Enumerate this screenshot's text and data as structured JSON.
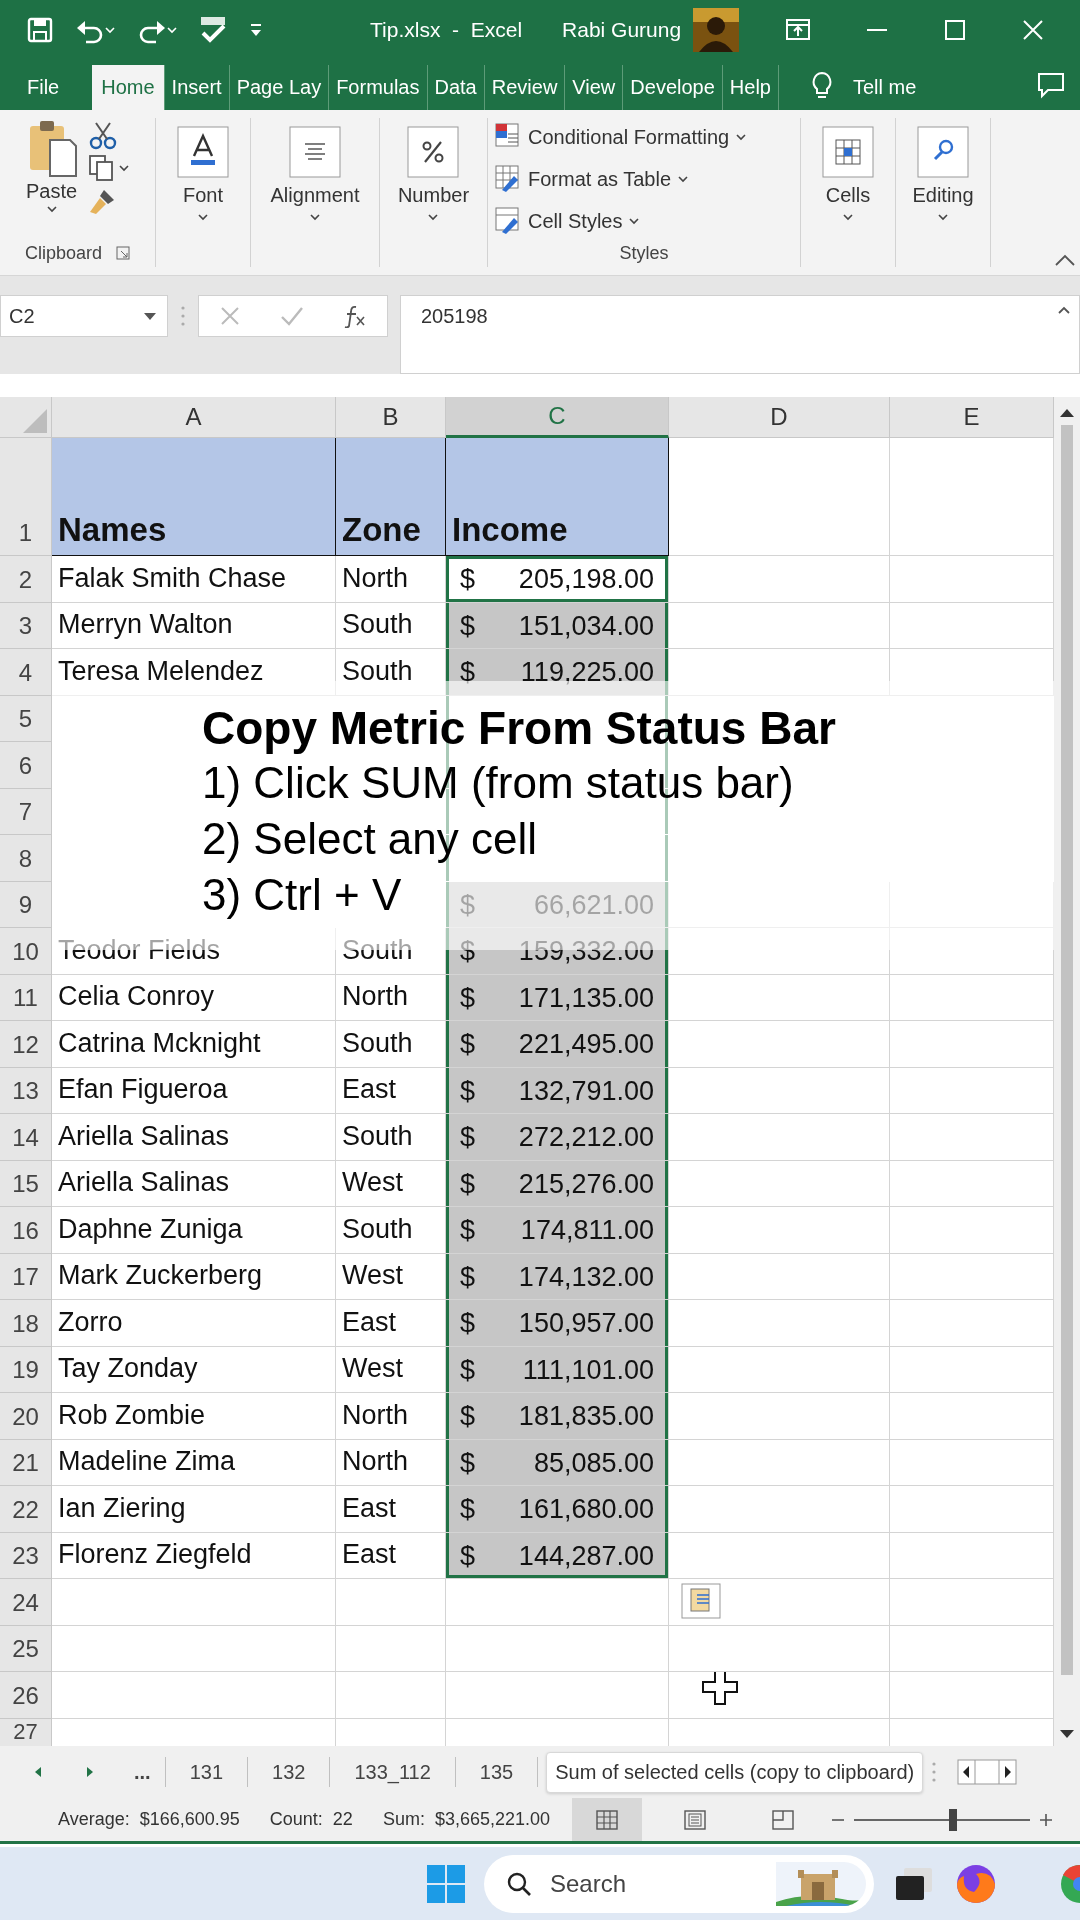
{
  "title_bar": {
    "file_title": "Tip.xlsx  -  Excel",
    "user": "Rabi Gurung"
  },
  "ribbon_tabs": [
    {
      "label": "File",
      "selected": false
    },
    {
      "label": "Home",
      "selected": true
    },
    {
      "label": "Insert",
      "selected": false
    },
    {
      "label": "Page Lay",
      "selected": false
    },
    {
      "label": "Formulas",
      "selected": false
    },
    {
      "label": "Data",
      "selected": false
    },
    {
      "label": "Review",
      "selected": false
    },
    {
      "label": "View",
      "selected": false
    },
    {
      "label": "Develope",
      "selected": false
    },
    {
      "label": "Help",
      "selected": false
    }
  ],
  "tell_me": "Tell me",
  "ribbon": {
    "clipboard": {
      "paste": "Paste",
      "label": "Clipboard"
    },
    "big_buttons": [
      {
        "kind": "font",
        "label": "Font"
      },
      {
        "kind": "alignment",
        "label": "Alignment"
      },
      {
        "kind": "number",
        "label": "Number"
      }
    ],
    "styles": {
      "items": [
        "Conditional Formatting",
        "Format as Table",
        "Cell Styles"
      ],
      "label": "Styles"
    },
    "end_buttons": [
      {
        "kind": "cells",
        "label": "Cells"
      },
      {
        "kind": "editing",
        "label": "Editing"
      }
    ]
  },
  "formula_bar": {
    "name_box": "C2",
    "value": "205198"
  },
  "columns": [
    {
      "label": "A",
      "selected": false
    },
    {
      "label": "B",
      "selected": false
    },
    {
      "label": "C",
      "selected": true
    },
    {
      "label": "D",
      "selected": false
    },
    {
      "label": "E",
      "selected": false
    }
  ],
  "rows": [
    {
      "number": "1",
      "header": true,
      "cells": [
        "Names",
        "Zone",
        "Income"
      ],
      "selected": false,
      "active": false
    },
    {
      "number": "2",
      "header": false,
      "cells": [
        "Falak Smith Chase",
        "North",
        "$ 205,198.00"
      ],
      "selected": true,
      "active": true
    },
    {
      "number": "3",
      "header": false,
      "cells": [
        "Merryn Walton",
        "South",
        "$ 151,034.00"
      ],
      "selected": true,
      "active": false
    },
    {
      "number": "4",
      "header": false,
      "cells": [
        "Teresa Melendez",
        "South",
        "$ 119,225.00"
      ],
      "selected": true,
      "active": false
    },
    {
      "number": "5",
      "header": false,
      "selected": true,
      "active": false
    },
    {
      "number": "6",
      "header": false,
      "selected": true,
      "active": false
    },
    {
      "number": "7",
      "header": false,
      "selected": true,
      "active": false
    },
    {
      "number": "8",
      "header": false,
      "selected": true,
      "active": false
    },
    {
      "number": "9",
      "header": false,
      "cells": [
        null,
        null,
        "$ 66,621.00"
      ],
      "selected": true,
      "active": false
    },
    {
      "number": "10",
      "header": false,
      "cells": [
        "Teodor Fields",
        "South",
        "$ 159,332.00"
      ],
      "selected": true,
      "active": false
    },
    {
      "number": "11",
      "header": false,
      "cells": [
        "Celia Conroy",
        "North",
        "$ 171,135.00"
      ],
      "selected": true,
      "active": false
    },
    {
      "number": "12",
      "header": false,
      "cells": [
        "Catrina Mcknight",
        "South",
        "$ 221,495.00"
      ],
      "selected": true,
      "active": false
    },
    {
      "number": "13",
      "header": false,
      "cells": [
        "Efan Figueroa",
        "East",
        "$ 132,791.00"
      ],
      "selected": true,
      "active": false
    },
    {
      "number": "14",
      "header": false,
      "cells": [
        "Ariella Salinas",
        "South",
        "$ 272,212.00"
      ],
      "selected": true,
      "active": false
    },
    {
      "number": "15",
      "header": false,
      "cells": [
        "Ariella Salinas",
        "West",
        "$ 215,276.00"
      ],
      "selected": true,
      "active": false
    },
    {
      "number": "16",
      "header": false,
      "cells": [
        "Daphne Zuniga",
        "South",
        "$ 174,811.00"
      ],
      "selected": true,
      "active": false
    },
    {
      "number": "17",
      "header": false,
      "cells": [
        "Mark Zuckerberg",
        "West",
        "$ 174,132.00"
      ],
      "selected": true,
      "active": false
    },
    {
      "number": "18",
      "header": false,
      "cells": [
        "Zorro",
        "East",
        "$ 150,957.00"
      ],
      "selected": true,
      "active": false
    },
    {
      "number": "19",
      "header": false,
      "cells": [
        "Tay Zonday",
        "West",
        "$ 111,101.00"
      ],
      "selected": true,
      "active": false
    },
    {
      "number": "20",
      "header": false,
      "cells": [
        "Rob Zombie",
        "North",
        "$ 181,835.00"
      ],
      "selected": true,
      "active": false
    },
    {
      "number": "21",
      "header": false,
      "cells": [
        "Madeline Zima",
        "North",
        "$ 85,085.00"
      ],
      "selected": true,
      "active": false
    },
    {
      "number": "22",
      "header": false,
      "cells": [
        "Ian Ziering",
        "East",
        "$ 161,680.00"
      ],
      "selected": true,
      "active": false
    },
    {
      "number": "23",
      "header": false,
      "cells": [
        "Florenz Ziegfeld",
        "East",
        "$ 144,287.00"
      ],
      "selected": true,
      "active": false
    },
    {
      "number": "24",
      "header": false,
      "selected": false,
      "active": false
    },
    {
      "number": "25",
      "header": false,
      "selected": false,
      "active": false
    },
    {
      "number": "26",
      "header": false,
      "selected": false,
      "active": false
    },
    {
      "number": "27",
      "header": false,
      "selected": false,
      "active": false
    }
  ],
  "overlay": {
    "title": "Copy Metric From Status Bar",
    "steps": [
      "1) Click SUM (from status bar)",
      "2) Select any cell",
      "3) Ctrl + V"
    ]
  },
  "sheet_tabs": {
    "more": "...",
    "tabs": [
      {
        "label": "131",
        "selected": false
      },
      {
        "label": "132",
        "selected": false
      },
      {
        "label": "133_112",
        "selected": false
      },
      {
        "label": "135",
        "selected": false
      }
    ],
    "tooltip": "Sum of selected cells (copy to clipboard)"
  },
  "status_bar": {
    "metrics": [
      {
        "label": "Average:",
        "value": "$166,600.95"
      },
      {
        "label": "Count:",
        "value": "22"
      },
      {
        "label": "Sum:",
        "value": "$3,665,221.00"
      }
    ],
    "views": [
      {
        "kind": "normal",
        "selected": true
      },
      {
        "kind": "page_layout",
        "selected": false
      },
      {
        "kind": "page_break",
        "selected": false
      }
    ],
    "zoom": {
      "level": 0.56
    }
  },
  "taskbar": {
    "search_placeholder": "Search"
  }
}
